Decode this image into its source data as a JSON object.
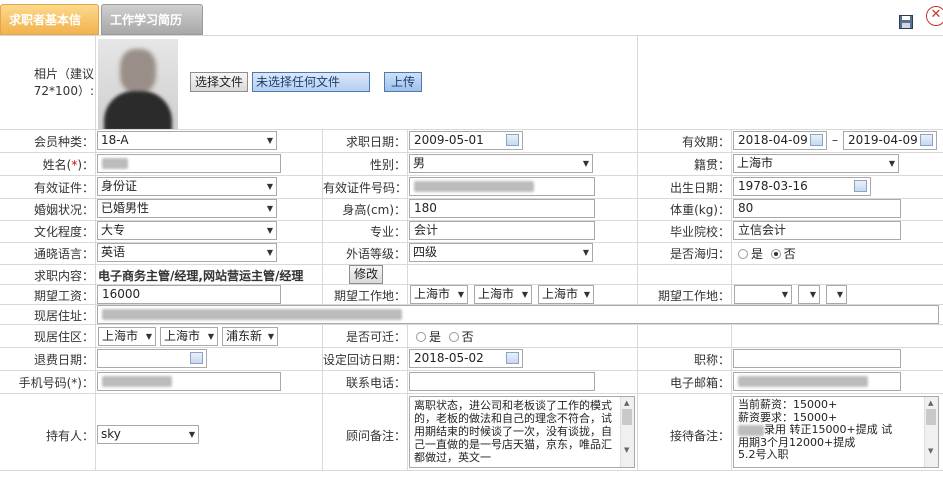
{
  "tabs": {
    "active": "求职者基本信息",
    "inactive": "工作学习简历"
  },
  "photo": {
    "label": "相片（建议72*100）:",
    "file_button": "选择文件",
    "file_status": "未选择任何文件",
    "upload_button": "上传"
  },
  "row1": {
    "member_type_label": "会员种类：",
    "member_type": "18-A",
    "job_date_label": "求职日期：",
    "job_date": "2009-05-01",
    "validity_label": "有效期：",
    "validity_from": "2018-04-09",
    "validity_sep": "–",
    "validity_to": "2019-04-09"
  },
  "row2": {
    "name_label": "姓名(*)：",
    "gender_label": "性别：",
    "gender": "男",
    "origin_label": "籍贯：",
    "origin": "上海市"
  },
  "row3": {
    "id_type_label": "有效证件：",
    "id_type": "身份证",
    "id_number_label": "有效证件号码：",
    "birth_label": "出生日期：",
    "birth": "1978-03-16"
  },
  "row4": {
    "marital_label": "婚姻状况：",
    "marital": "已婚男性",
    "height_label": "身高(cm)：",
    "height": "180",
    "weight_label": "体重(kg)：",
    "weight": "80"
  },
  "row5": {
    "education_label": "文化程度：",
    "education": "大专",
    "major_label": "专业：",
    "major": "会计",
    "school_label": "毕业院校：",
    "school": "立信会计"
  },
  "row6": {
    "language_label": "通晓语言：",
    "language": "英语",
    "lang_level_label": "外语等级：",
    "lang_level": "四级",
    "overseas_label": "是否海归：",
    "yes": "是",
    "no": "否"
  },
  "row7": {
    "job_content_label": "求职内容：",
    "job_content": "电子商务主管/经理,网站营运主管/经理",
    "modify_button": "修改"
  },
  "row8": {
    "salary_label": "期望工资：",
    "salary": "16000",
    "work_place_label": "期望工作地：",
    "wp1": "上海市",
    "wp2": "上海市",
    "wp3": "上海市",
    "work_place2_label": "期望工作地："
  },
  "row9": {
    "address_label": "现居住址："
  },
  "row10": {
    "residence_label": "现居住区：",
    "res1": "上海市",
    "res2": "上海市",
    "res3": "浦东新",
    "relocate_label": "是否可迁：",
    "yes": "是",
    "no": "否"
  },
  "row11": {
    "refund_label": "退费日期：",
    "revisit_label": "设定回访日期：",
    "revisit": "2018-05-02",
    "title_label": "职称："
  },
  "row12": {
    "phone_label": "手机号码(*)：",
    "tel_label": "联系电话：",
    "email_label": "电子邮箱："
  },
  "row13": {
    "holder_label": "持有人：",
    "holder": "sky",
    "consultant_note_label": "顾问备注：",
    "consultant_note": "离职状态，进公司和老板谈了工作的模式的，老板的做法和自己的理念不符合，试用期结束的时候谈了一次，没有谈拢，自己一直做的是一号店天猫，京东，唯品汇都做过，英文一",
    "reception_note_label": "接待备注：",
    "reception_note_lines": [
      "当前薪资：15000+",
      "薪资要求：15000+",
      "录用  转正15000+提成  试",
      "用期3个月12000+提成",
      "5.2号入职"
    ]
  },
  "colors": {
    "tab_active": "#f3b24c",
    "tab_inactive": "#a8a8a8",
    "required": "#dd0000"
  }
}
